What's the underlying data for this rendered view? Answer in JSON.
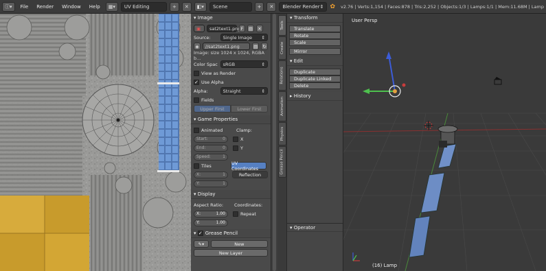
{
  "topbar": {
    "menus": [
      "File",
      "Render",
      "Window",
      "Help"
    ],
    "layout": "UV Editing",
    "scene": "Scene",
    "engine": "Blender Render",
    "stats": "v2.76 | Verts:1,154 | Faces:878 | Tris:2,252 | Objects:1/3 | Lamps:1/1 | Mem:11.68M | Lamp"
  },
  "image_panel": {
    "header": "Image",
    "image_name": "sat2text1.png",
    "f_label": "F",
    "source_label": "Source:",
    "source_value": "Single Image",
    "filepath": "//sat2text1.png",
    "info": "Image: size 1024 x 1024, RGBA b...",
    "color_space_label": "Color Spac",
    "color_space_value": "sRGB",
    "view_as_render": "View as Render",
    "use_alpha": "Use Alpha",
    "alpha_label": "Alpha:",
    "alpha_value": "Straight",
    "fields": "Fields",
    "upper_first": "Upper First",
    "lower_first": "Lower First"
  },
  "game_panel": {
    "header": "Game Properties",
    "animated": "Animated",
    "clamp": "Clamp:",
    "start_label": "Start:",
    "start_value": "0",
    "end_label": "End:",
    "end_value": "0",
    "speed_label": "Speed:",
    "speed_value": "1",
    "x": "X",
    "y": "Y",
    "tiles": "Tiles",
    "uv_coordinates": "UV Coordinates",
    "reflection": "Reflection",
    "tx_label": "X:",
    "tx_value": "1",
    "ty_label": "Y:",
    "ty_value": "1"
  },
  "display_panel": {
    "header": "Display",
    "aspect_ratio": "Aspect Ratio:",
    "coordinates": "Coordinates:",
    "ax_label": "X:",
    "ax_value": "1.00",
    "ay_label": "Y:",
    "ay_value": "1.00",
    "repeat": "Repeat"
  },
  "grease_panel": {
    "header": "Grease Pencil",
    "new": "New",
    "new_layer": "New Layer"
  },
  "tabs": [
    "Tools",
    "Create",
    "Relations",
    "Animation",
    "Physics",
    "Grease Pencil"
  ],
  "tools": {
    "transform_header": "Transform",
    "translate": "Translate",
    "rotate": "Rotate",
    "scale": "Scale",
    "mirror": "Mirror",
    "edit_header": "Edit",
    "duplicate": "Duplicate",
    "duplicate_linked": "Duplicate Linked",
    "delete": "Delete",
    "history_header": "History",
    "operator_header": "Operator"
  },
  "viewport": {
    "view_label": "User Persp",
    "object_label": "(16) Lamp"
  },
  "colors": {
    "accent_blue": "#5680c2",
    "axis_x": "#c83c3c",
    "axis_y": "#4ec14e",
    "axis_z": "#3c5cd8"
  }
}
